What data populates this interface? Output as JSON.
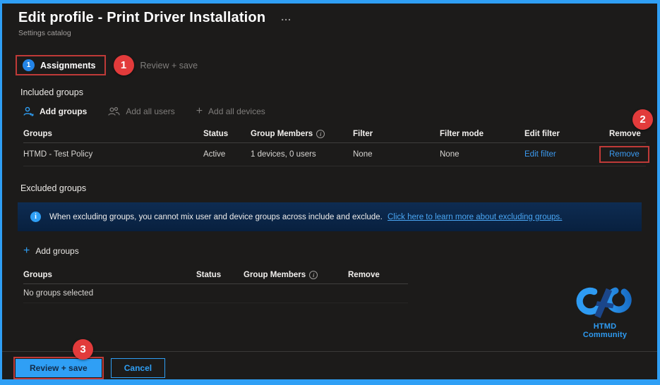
{
  "colors": {
    "accent_blue": "#2f9ff5",
    "annotation_red": "#e23b3b",
    "highlight_box_red": "#bf3a38",
    "background": "#1c1b1a",
    "banner_navy": "#0b2648"
  },
  "header": {
    "title": "Edit profile - Print Driver Installation",
    "ellipsis": "...",
    "subtitle": "Settings catalog"
  },
  "tabs": {
    "assignments": {
      "step": "1",
      "label": "Assignments"
    },
    "review_save": {
      "label": "Review + save"
    }
  },
  "annotations": {
    "badge1": "1",
    "badge2": "2",
    "badge3": "3"
  },
  "included": {
    "heading": "Included groups",
    "toolbar": {
      "add_groups": "Add groups",
      "add_all_users": "Add all users",
      "add_all_devices": "Add all devices"
    },
    "table": {
      "headers": [
        "Groups",
        "Status",
        "Group Members",
        "Filter",
        "Filter mode",
        "Edit filter",
        "Remove"
      ],
      "info_glyph": "i",
      "row": {
        "group": "HTMD - Test Policy",
        "status": "Active",
        "members": "1 devices, 0 users",
        "filter": "None",
        "filter_mode": "None",
        "edit_filter_link": "Edit filter",
        "remove_link": "Remove"
      }
    }
  },
  "excluded": {
    "heading": "Excluded groups",
    "banner": {
      "info_glyph": "i",
      "text": "When excluding groups, you cannot mix user and device groups across include and exclude.",
      "link": "Click here to learn more about excluding groups."
    },
    "add_groups": "Add groups",
    "table": {
      "headers": [
        "Groups",
        "Status",
        "Group Members",
        "Remove"
      ],
      "info_glyph": "i",
      "empty": "No groups selected"
    }
  },
  "logo": {
    "text": "HTMD Community"
  },
  "footer": {
    "review_save": "Review + save",
    "cancel": "Cancel"
  },
  "glyphs": {
    "plus": "+"
  }
}
